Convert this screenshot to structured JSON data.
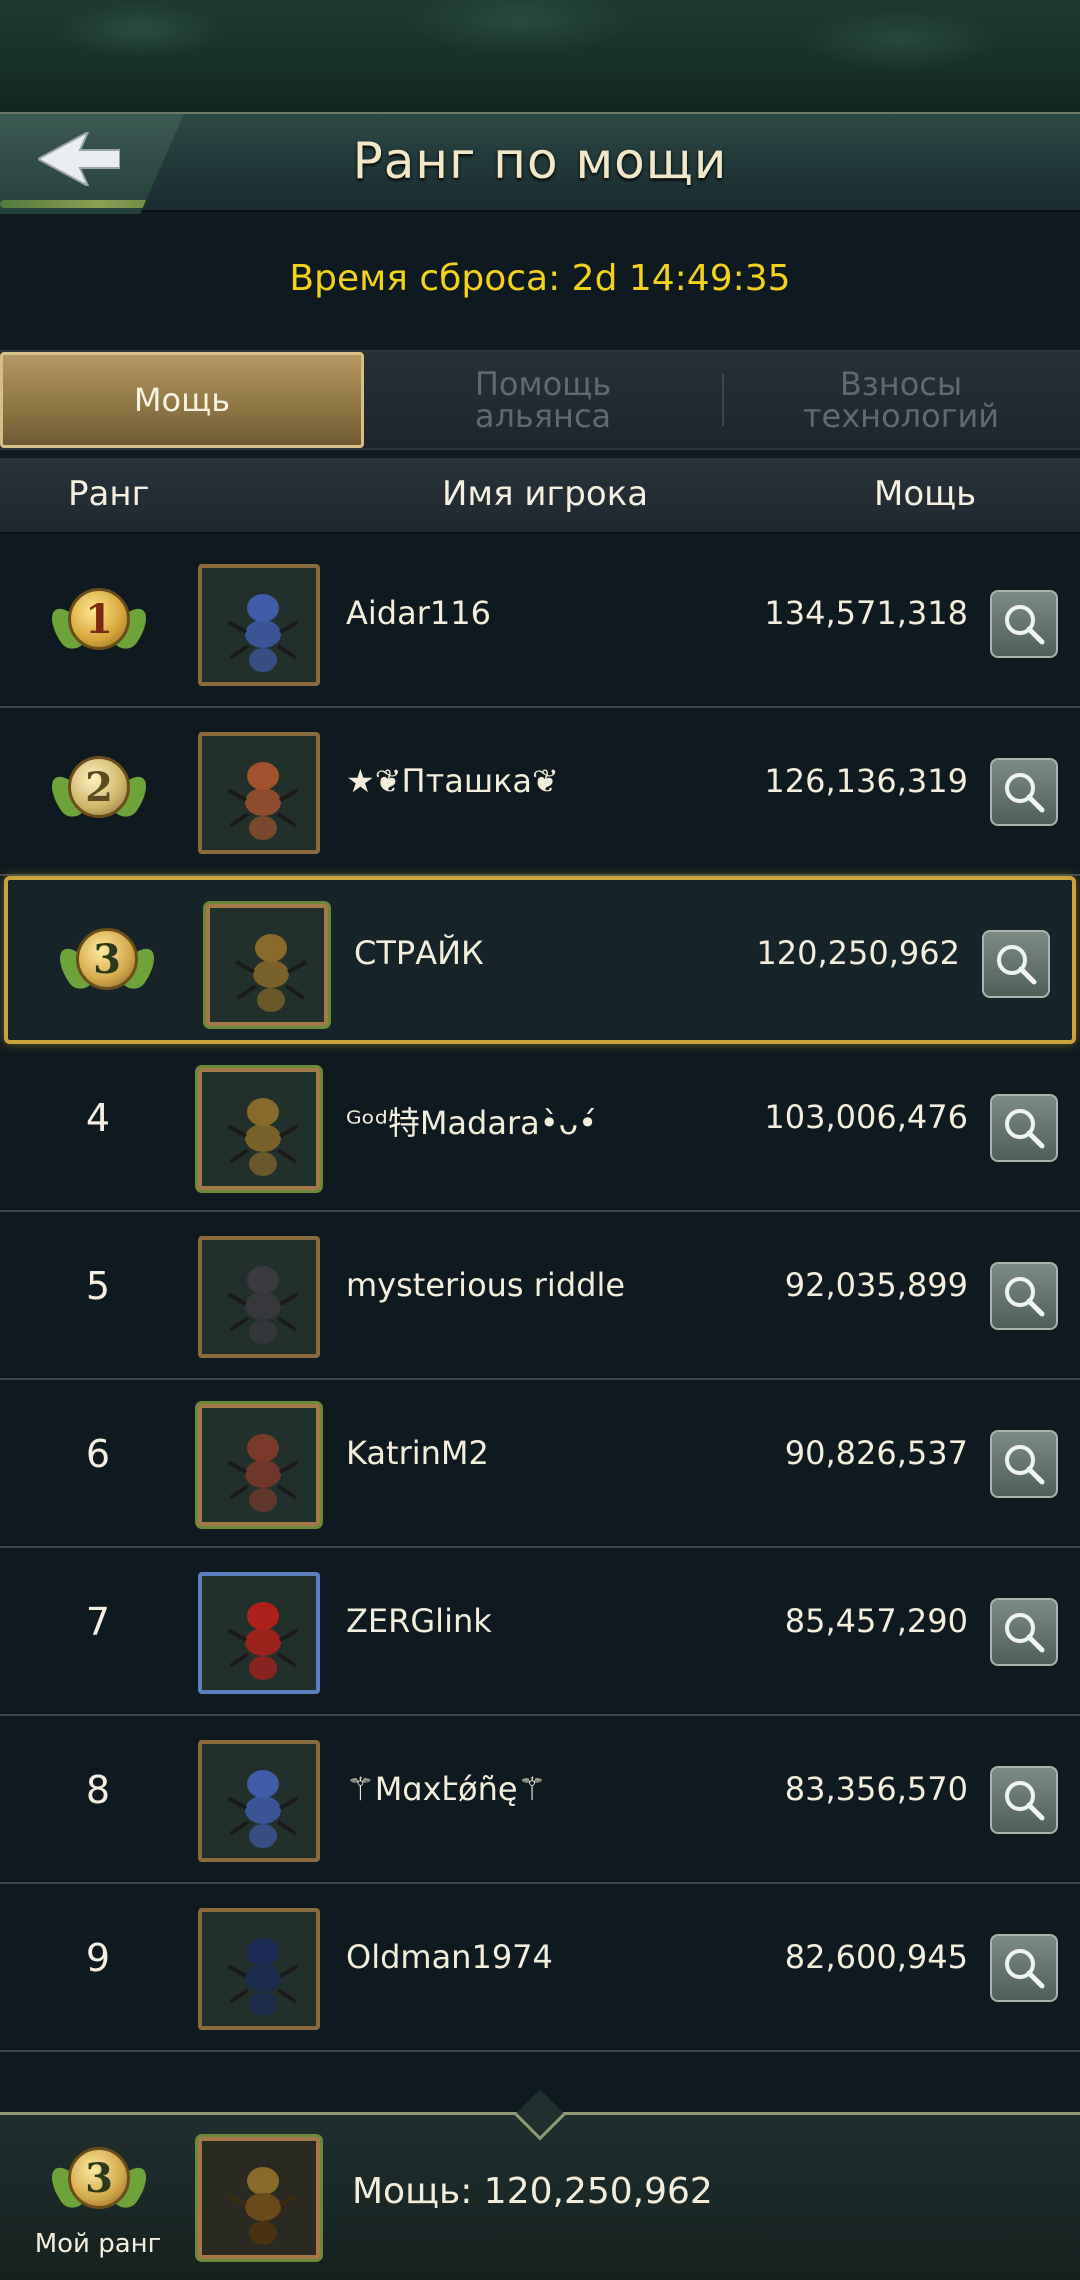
{
  "header": {
    "title": "Ранг по мощи",
    "back_icon": "back-arrow-icon"
  },
  "reset_timer": "Время сброса: 2d 14:49:35",
  "tabs": [
    {
      "label": "Мощь",
      "active": true
    },
    {
      "label": "Помощь альянса",
      "active": false
    },
    {
      "label": "Взносы технологий",
      "active": false
    }
  ],
  "columns": {
    "rank": "Ранг",
    "player": "Имя игрока",
    "power": "Мощь"
  },
  "rows": [
    {
      "rank": "1",
      "name": "Aidar116",
      "power": "134,571,318",
      "medal": true,
      "highlight": false,
      "avatar_color": "#3e5ca8"
    },
    {
      "rank": "2",
      "name": "★❦Пташка❦",
      "power": "126,136,319",
      "medal": true,
      "highlight": false,
      "avatar_color": "#a0522d"
    },
    {
      "rank": "3",
      "name": "СТРАЙК",
      "power": "120,250,962",
      "medal": true,
      "highlight": true,
      "avatar_color": "#8a6a2a"
    },
    {
      "rank": "4",
      "name": "ᴳᵒᵈ特Madara•̀ᴗ•́",
      "power": "103,006,476",
      "medal": false,
      "highlight": false,
      "avatar_color": "#8a6a2a"
    },
    {
      "rank": "5",
      "name": "mysterious riddle",
      "power": "92,035,899",
      "medal": false,
      "highlight": false,
      "avatar_color": "#3a3a40"
    },
    {
      "rank": "6",
      "name": "KatrinM2",
      "power": "90,826,537",
      "medal": false,
      "highlight": false,
      "avatar_color": "#7a3a2a"
    },
    {
      "rank": "7",
      "name": "ZERGlink",
      "power": "85,457,290",
      "medal": false,
      "highlight": false,
      "avatar_color": "#b0201a"
    },
    {
      "rank": "8",
      "name": "⚚Mɑxէǿñę⚚",
      "power": "83,356,570",
      "medal": false,
      "highlight": false,
      "avatar_color": "#3e5ca8"
    },
    {
      "rank": "9",
      "name": "Oldman1974",
      "power": "82,600,945",
      "medal": false,
      "highlight": false,
      "avatar_color": "#1a2a55"
    }
  ],
  "my_rank": {
    "rank": "3",
    "label": "Мой ранг",
    "power": "Мощь: 120,250,962"
  },
  "icons": {
    "inspect": "magnifier-icon"
  }
}
